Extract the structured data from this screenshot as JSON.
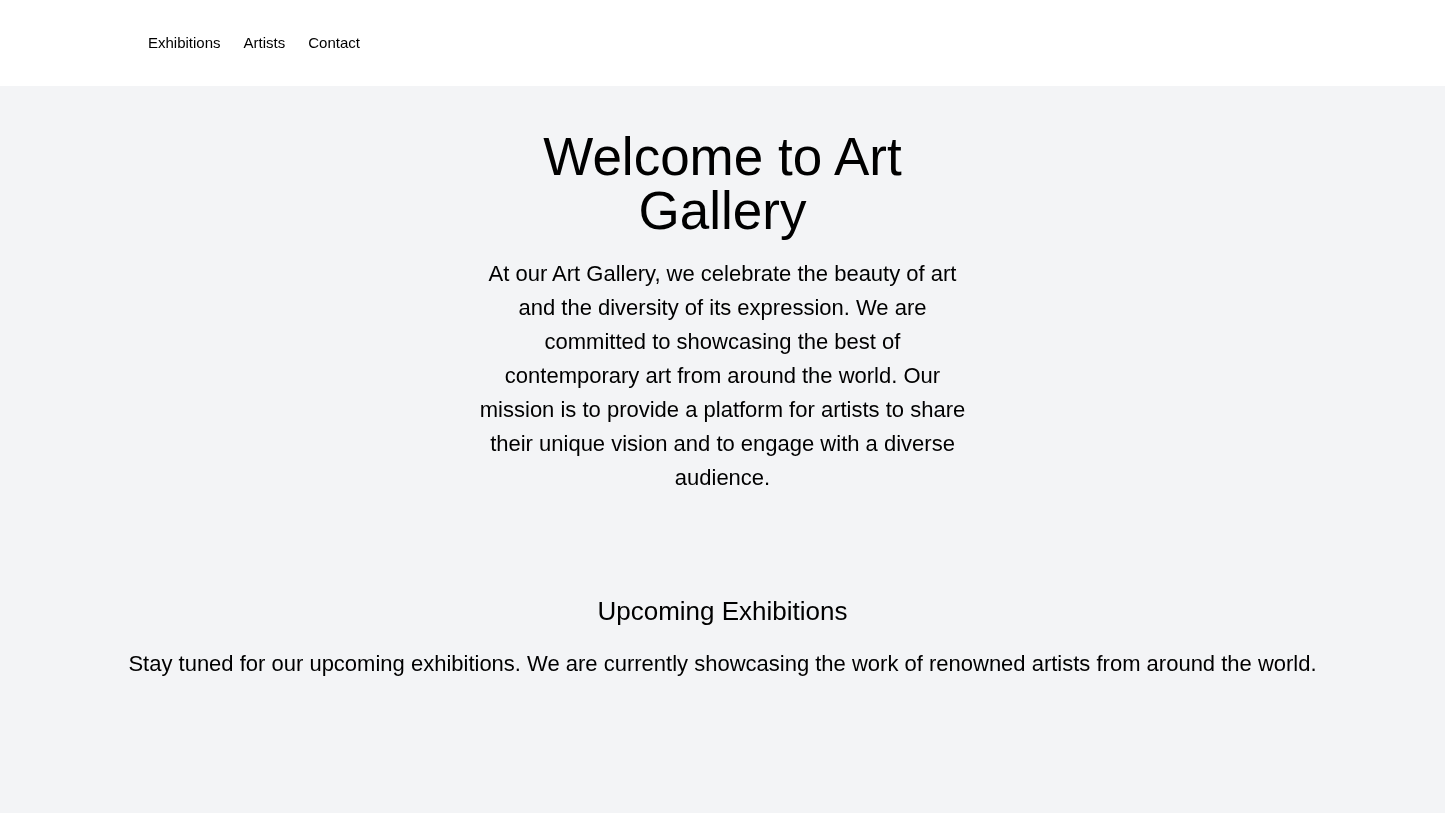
{
  "nav": {
    "links": [
      "Exhibitions",
      "Artists",
      "Contact"
    ]
  },
  "hero": {
    "title": "Welcome to Art Gallery",
    "text": "At our Art Gallery, we celebrate the beauty of art and the diversity of its expression. We are committed to showcasing the best of contemporary art from around the world. Our mission is to provide a platform for artists to share their unique vision and to engage with a diverse audience."
  },
  "upcoming": {
    "heading": "Upcoming Exhibitions",
    "text": "Stay tuned for our upcoming exhibitions. We are currently showcasing the work of renowned artists from around the world."
  }
}
